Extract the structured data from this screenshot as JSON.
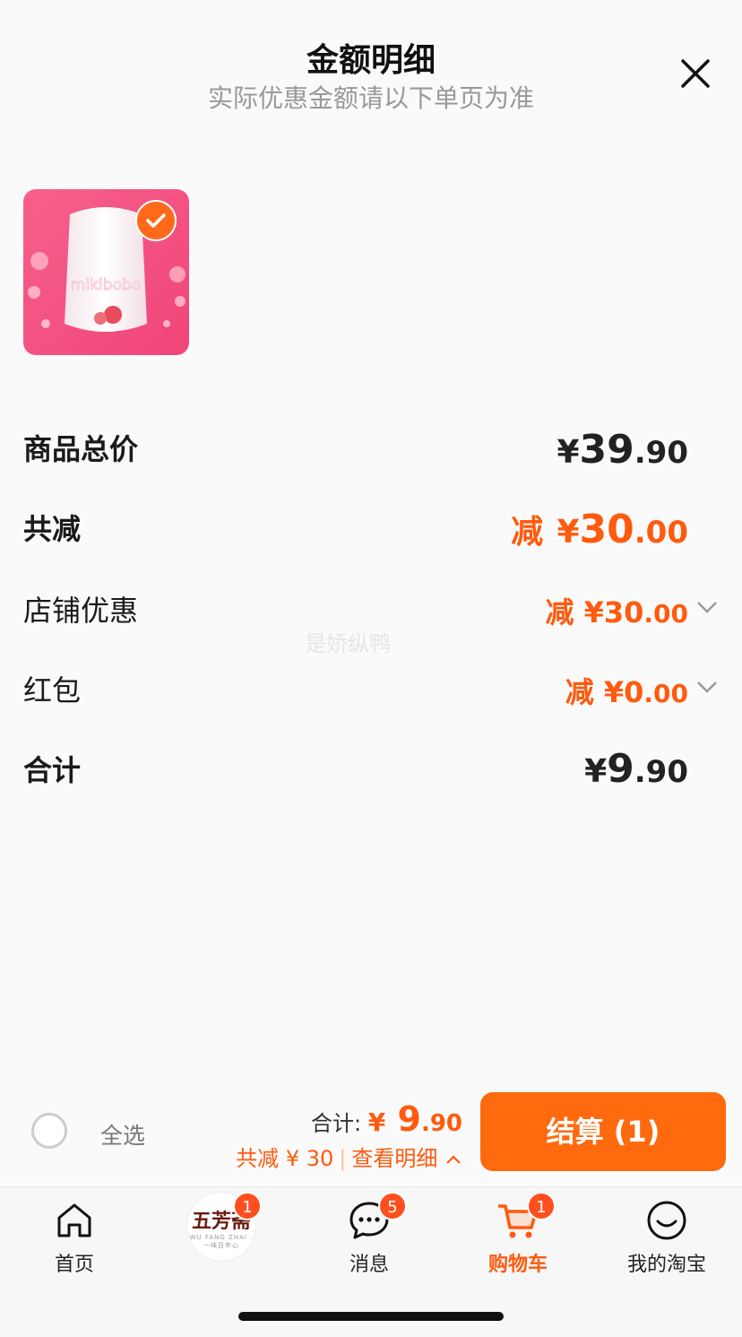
{
  "header": {
    "title": "金额明细",
    "subtitle": "实际优惠金额请以下单页为准"
  },
  "product": {
    "brand_text": "mikibobo",
    "selected": true
  },
  "summary": {
    "goods_total": {
      "label": "商品总价",
      "yen": "¥",
      "int": "39",
      "dec": ".90"
    },
    "total_reduction": {
      "label": "共减",
      "prefix": "减",
      "yen": "¥",
      "int": "30",
      "dec": ".00"
    },
    "shop_discount": {
      "label": "店铺优惠",
      "prefix": "减",
      "yen": "¥",
      "int": "30",
      "dec": ".00"
    },
    "red_packet": {
      "label": "红包",
      "prefix": "减",
      "yen": "¥",
      "int": "0",
      "dec": ".00"
    },
    "subtotal": {
      "label": "合计",
      "yen": "¥",
      "int": "9",
      "dec": ".90"
    }
  },
  "watermark": "是娇纵鸭",
  "checkout_bar": {
    "select_all": "全选",
    "total_label": "合计:",
    "total_yen": "¥",
    "total_int": "9",
    "total_dec": ".90",
    "reduction_text": "共减 ¥ 30",
    "detail_link": "查看明细",
    "checkout_label": "结算 (1)"
  },
  "tabbar": {
    "items": [
      {
        "label": "首页",
        "icon": "home-icon"
      },
      {
        "label": "",
        "icon": "shop-logo",
        "badge": "1",
        "logo_cn": "五芳斋",
        "logo_en": "WU FANG ZHAI · 一味百年心"
      },
      {
        "label": "消息",
        "icon": "message-icon",
        "badge": "5"
      },
      {
        "label": "购物车",
        "icon": "cart-icon",
        "badge": "1",
        "active": true
      },
      {
        "label": "我的淘宝",
        "icon": "smile-icon"
      }
    ]
  },
  "colors": {
    "accent": "#ff5a0e",
    "button": "#ff6a0e",
    "badge": "#ff4f1e"
  }
}
